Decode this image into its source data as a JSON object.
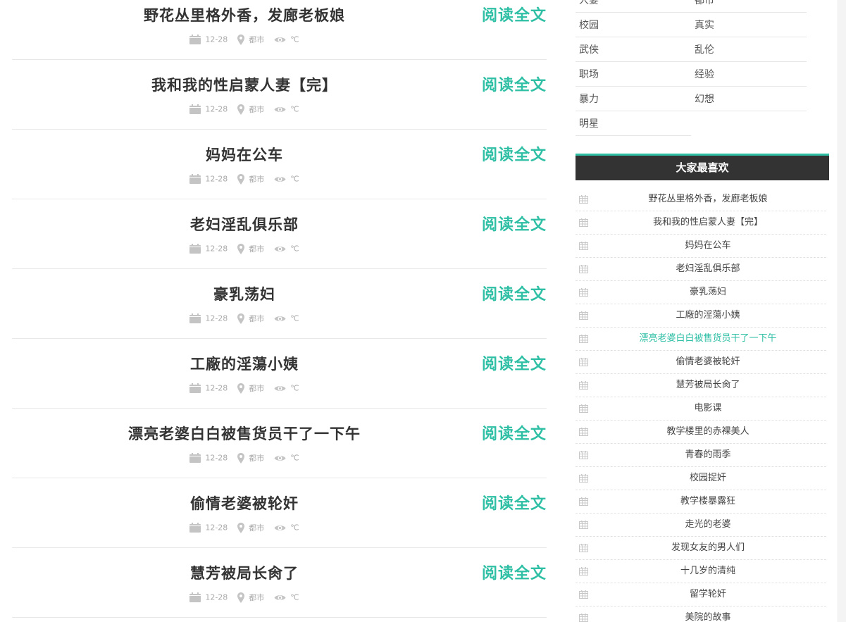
{
  "articles": [
    {
      "title": "野花丛里格外香，发廊老板娘",
      "date": "12-28",
      "category": "都市",
      "views": "℃"
    },
    {
      "title": "我和我的性启蒙人妻【完】",
      "date": "12-28",
      "category": "都市",
      "views": "℃"
    },
    {
      "title": "妈妈在公车",
      "date": "12-28",
      "category": "都市",
      "views": "℃"
    },
    {
      "title": "老妇淫乱俱乐部",
      "date": "12-28",
      "category": "都市",
      "views": "℃"
    },
    {
      "title": "豪乳荡妇",
      "date": "12-28",
      "category": "都市",
      "views": "℃"
    },
    {
      "title": "工廠的淫蕩小姨",
      "date": "12-28",
      "category": "都市",
      "views": "℃"
    },
    {
      "title": "漂亮老婆白白被售货员干了一下午",
      "date": "12-28",
      "category": "都市",
      "views": "℃"
    },
    {
      "title": "偷情老婆被轮奸",
      "date": "12-28",
      "category": "都市",
      "views": "℃"
    },
    {
      "title": "慧芳被局长肏了",
      "date": "12-28",
      "category": "都市",
      "views": "℃"
    }
  ],
  "read_more_label": "阅读全文",
  "categories": [
    "人妻",
    "都市",
    "校园",
    "真实",
    "武侠",
    "乱伦",
    "职场",
    "经验",
    "暴力",
    "幻想",
    "明星"
  ],
  "favorites_title": "大家最喜欢",
  "favorites": [
    {
      "title": "野花丛里格外香，发廊老板娘",
      "active": false
    },
    {
      "title": "我和我的性启蒙人妻【完】",
      "active": false
    },
    {
      "title": "妈妈在公车",
      "active": false
    },
    {
      "title": "老妇淫乱俱乐部",
      "active": false
    },
    {
      "title": "豪乳荡妇",
      "active": false
    },
    {
      "title": "工廠的淫蕩小姨",
      "active": false
    },
    {
      "title": "漂亮老婆白白被售货员干了一下午",
      "active": true
    },
    {
      "title": "偷情老婆被轮奸",
      "active": false
    },
    {
      "title": "慧芳被局长肏了",
      "active": false
    },
    {
      "title": "电影课",
      "active": false
    },
    {
      "title": "教学楼里的赤裸美人",
      "active": false
    },
    {
      "title": "青春的雨季",
      "active": false
    },
    {
      "title": "校园捉奸",
      "active": false
    },
    {
      "title": "教学楼暴露狂",
      "active": false
    },
    {
      "title": "走光的老婆",
      "active": false
    },
    {
      "title": "发现女友的男人们",
      "active": false
    },
    {
      "title": "十几岁的清纯",
      "active": false
    },
    {
      "title": "留学轮奸",
      "active": false
    },
    {
      "title": "美院的故事",
      "active": false
    }
  ],
  "colors": {
    "accent": "#2ebfa5",
    "header_bg": "#333333",
    "meta": "#aaaaaa"
  },
  "icons": {
    "date": "calendar-icon",
    "category": "location-pin-icon",
    "views": "eye-icon",
    "favorite_bullet": "grid-calendar-icon"
  }
}
